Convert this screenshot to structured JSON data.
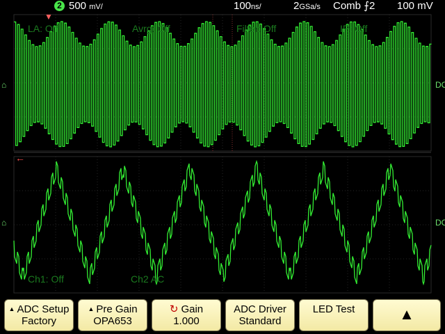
{
  "status": {
    "channel_number": "2",
    "volts_per_div": "500",
    "volts_unit": "mV/",
    "time_per_div": "100",
    "time_unit": "ns/",
    "sample_rate": "2",
    "sample_unit": "GSa/s",
    "trigger_mode": "Comb",
    "trigger_source": "2",
    "trigger_level": "100 mV"
  },
  "overlay": {
    "la": "LA: Off",
    "avrg": "Avrg: Off",
    "filter": "Filter: Off",
    "ip": "IP: Off",
    "ch1": "Ch1: Off",
    "ch2": "Ch2 AC"
  },
  "side_marker": "DC",
  "trace": {
    "color": "#33ee33"
  },
  "softkeys": [
    {
      "top": "ADC Setup",
      "bottom": "Factory"
    },
    {
      "top": "Pre Gain",
      "bottom": "OPA653"
    },
    {
      "top": "Gain",
      "bottom": "1.000"
    },
    {
      "top": "ADC Driver",
      "bottom": "Standard"
    },
    {
      "top": "LED Test",
      "bottom": ""
    }
  ]
}
